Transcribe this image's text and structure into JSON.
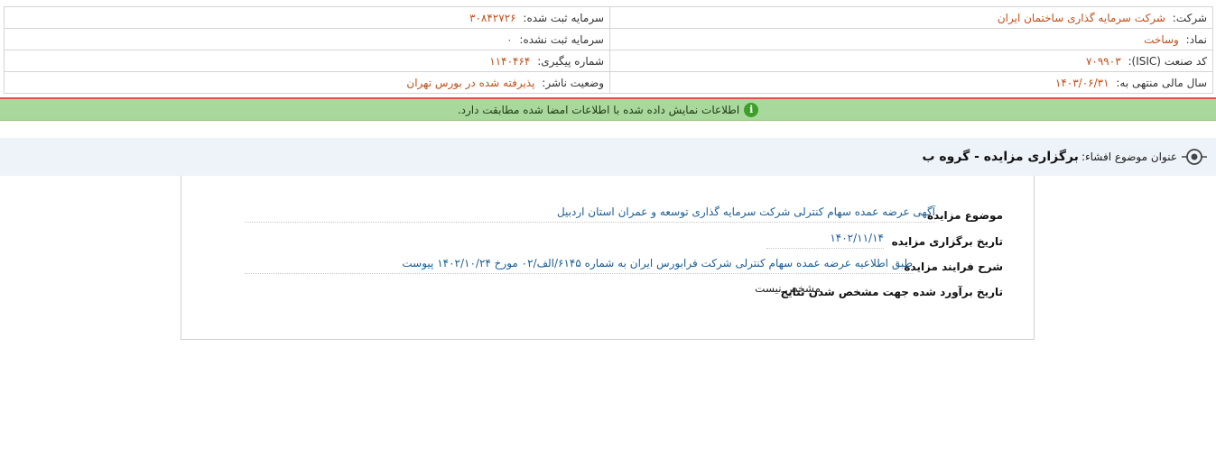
{
  "company_info": {
    "company_label": "شرکت:",
    "company_value": "شرکت سرمایه گذاری ساختمان ایران",
    "registered_capital_label": "سرمایه ثبت شده:",
    "registered_capital_value": "۳۰۸۴۲۷۲۶",
    "symbol_label": "نماد:",
    "symbol_value": "وساخت",
    "unregistered_capital_label": "سرمایه ثبت نشده:",
    "unregistered_capital_value": "۰",
    "isic_label": "کد صنعت (ISIC):",
    "isic_value": "۷۰۹۹۰۳",
    "tracking_label": "شماره پیگیری:",
    "tracking_value": "۱۱۴۰۴۶۴",
    "fiscal_year_label": "سال مالی منتهی به:",
    "fiscal_year_value": "۱۴۰۳/۰۶/۳۱",
    "publisher_status_label": "وضعیت ناشر:",
    "publisher_status_value": "پذیرفته شده در بورس تهران"
  },
  "banner": {
    "text": "اطلاعات نمایش داده شده با اطلاعات امضا شده مطابقت دارد.",
    "icon": "info-icon",
    "color": "#a9d89d"
  },
  "disclosure": {
    "title_label": "عنوان موضوع افشاء:",
    "title_value": "برگزاری مزایده - گروه ب"
  },
  "details": [
    {
      "label": "موضوع مزایده",
      "value": "آگهی عرضه عمده سهام کنترلی شرکت سرمایه گذاری توسعه و عمران استان اردبیل"
    },
    {
      "label": "تاریخ برگزاری مزایده",
      "value": "۱۴۰۲/۱۱/۱۴"
    },
    {
      "label": "شرح فرایند مزایده",
      "value": "طبق اطلاعیه عرضه عمده سهام کنترلی شرکت فرابورس ایران به شماره ۶۱۴۵/الف/۰۲ مورخ ۱۴۰۲/۱۰/۲۴ پیوست"
    },
    {
      "label": "تاریخ برآورد شده جهت مشخص شدن نتایج",
      "value": "مشخص نیست"
    }
  ],
  "colors": {
    "value_orange": "#c0501b",
    "value_blue": "#1b5e95",
    "title_bar_bg": "#eef3f9"
  }
}
